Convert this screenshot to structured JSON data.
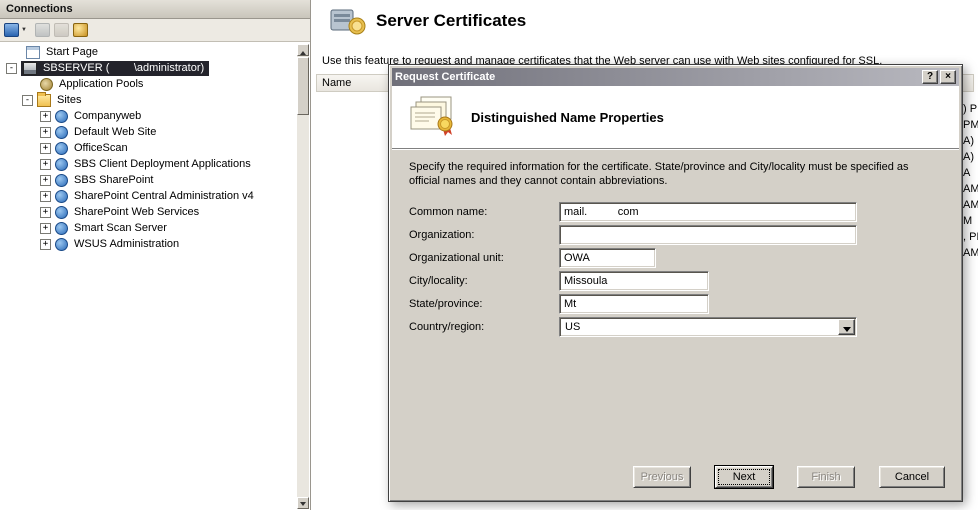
{
  "icons": {
    "caret_down": "▼",
    "expand_plus": "+",
    "collapse_minus": "-"
  },
  "connections": {
    "header": "Connections",
    "tree": {
      "start_page": "Start Page",
      "server": "SBSERVER (        \\administrator)",
      "application_pools": "Application Pools",
      "sites": "Sites",
      "site_items": [
        "Companyweb",
        "Default Web Site",
        "OfficeScan",
        "SBS Client Deployment Applications",
        "SBS SharePoint",
        "SharePoint Central Administration v4",
        "SharePoint Web Services",
        "Smart Scan Server",
        "WSUS Administration"
      ]
    }
  },
  "main": {
    "page_title": "Server Certificates",
    "description": "Use this feature to request and manage certificates that the Web server can use with Web sites configured for SSL.",
    "list": {
      "name_column": "Name",
      "right_edge_fragments": [
        ") P",
        "PM",
        "A)",
        "A)",
        "A",
        "AM",
        "AM",
        "M",
        ", PM",
        "AM"
      ]
    }
  },
  "dialog": {
    "title": "Request Certificate",
    "titlebar_buttons": {
      "help": "?",
      "close": "×"
    },
    "section_title": "Distinguished Name Properties",
    "instructions": "Specify the required information for the certificate. State/province and City/locality must be specified as official names and they cannot contain abbreviations.",
    "fields": [
      {
        "label": "Common name:",
        "value": "mail.          com"
      },
      {
        "label": "Organization:",
        "value": ""
      },
      {
        "label": "Organizational unit:",
        "value": "OWA"
      },
      {
        "label": "City/locality:",
        "value": "Missoula"
      },
      {
        "label": "State/province:",
        "value": "Mt"
      },
      {
        "label": "Country/region:",
        "value": "US"
      }
    ],
    "buttons": [
      {
        "label": "Previous"
      },
      {
        "label": "Next"
      },
      {
        "label": "Finish"
      },
      {
        "label": "Cancel"
      }
    ]
  }
}
